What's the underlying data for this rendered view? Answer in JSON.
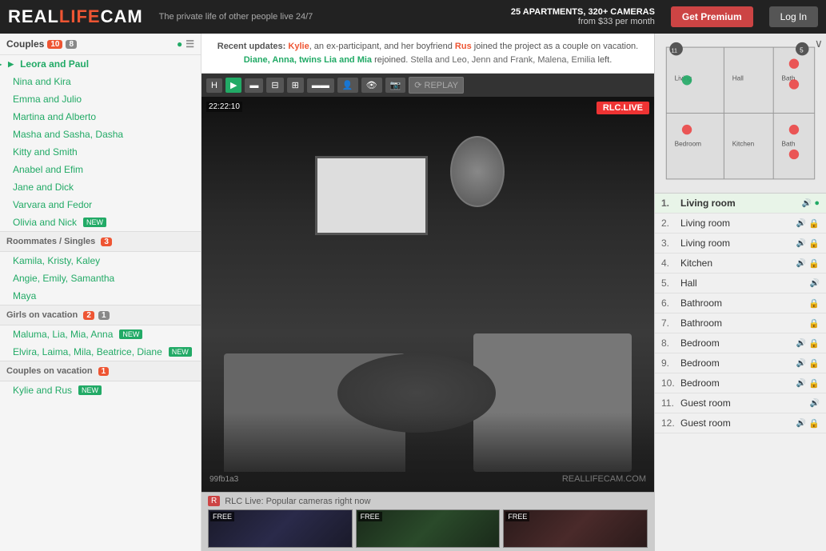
{
  "header": {
    "logo_real": "REAL",
    "logo_life": "LIFE",
    "logo_cam": "CAM",
    "tagline": "The private life of other people live 24/7",
    "stats_line1": "25 APARTMENTS, 320+ CAMERAS",
    "stats_line2": "from $33 per month",
    "btn_premium": "Get Premium",
    "btn_login": "Log In"
  },
  "news": {
    "text": "Recent updates: Kylie, an ex-participant, and her boyfriend Rus joined the project as a couple on vacation. Diane, Anna, twins Lia and Mia rejoined. Stella and Leo, Jenn and Frank, Malena, Emilia left.",
    "highlighted_names": [
      "Kylie",
      "Rus",
      "Diane, Anna, twins Lia and Mia",
      "Stella and Leo, Jenn and Frank, Malena, Emilia"
    ]
  },
  "sidebar": {
    "couples_label": "Couples",
    "couples_badge_green": "10",
    "couples_badge_gray": "8",
    "couples": [
      {
        "name": "Leora and Paul",
        "active": true
      },
      {
        "name": "Nina and Kira"
      },
      {
        "name": "Emma and Julio"
      },
      {
        "name": "Martina and Alberto"
      },
      {
        "name": "Masha and Sasha, Dasha"
      },
      {
        "name": "Kitty and Smith"
      },
      {
        "name": "Anabel and Efim"
      },
      {
        "name": "Jane and Dick"
      },
      {
        "name": "Varvara and Fedor"
      },
      {
        "name": "Olivia and Nick",
        "new": true
      }
    ],
    "roommates_label": "Roommates / Singles",
    "roommates_badge": "3",
    "roommates": [
      {
        "name": "Kamila, Kristy, Kaley"
      },
      {
        "name": "Angie, Emily, Samantha"
      },
      {
        "name": "Maya"
      }
    ],
    "girls_label": "Girls on vacation",
    "girls_badge_green": "2",
    "girls_badge_gray": "1",
    "girls": [
      {
        "name": "Maluma, Lia, Mia, Anna",
        "new": true
      },
      {
        "name": "Elvira, Laima, Mila, Beatrice, Diane",
        "new": true
      }
    ],
    "couples_vacation_label": "Couples on vacation",
    "couples_vacation_badge": "1",
    "couples_vacation": [
      {
        "name": "Kylie and Rus",
        "new": true
      }
    ]
  },
  "camera": {
    "timestamp": "22:22:10",
    "live_text": "RLC.LIVE",
    "watermark": "REALLIFECAM.COM",
    "cam_id": "99fb1a3"
  },
  "rooms": [
    {
      "num": "1.",
      "name": "Living room",
      "active": true,
      "sound": true,
      "green": true
    },
    {
      "num": "2.",
      "name": "Living room",
      "sound": true,
      "lock": true
    },
    {
      "num": "3.",
      "name": "Living room",
      "sound": true,
      "lock": true
    },
    {
      "num": "4.",
      "name": "Kitchen",
      "sound": true,
      "lock": true
    },
    {
      "num": "5.",
      "name": "Hall",
      "sound": true
    },
    {
      "num": "6.",
      "name": "Bathroom",
      "lock": true
    },
    {
      "num": "7.",
      "name": "Bathroom",
      "lock": true
    },
    {
      "num": "8.",
      "name": "Bedroom",
      "sound": true,
      "lock": true
    },
    {
      "num": "9.",
      "name": "Bedroom",
      "sound": true,
      "lock": true
    },
    {
      "num": "10.",
      "name": "Bedroom",
      "sound": true,
      "lock": true
    },
    {
      "num": "11.",
      "name": "Guest room",
      "sound": true
    },
    {
      "num": "12.",
      "name": "Guest room",
      "sound": true,
      "lock": true
    }
  ],
  "bottom": {
    "popular_label": "RLC Live: Popular cameras right now",
    "thumbs": [
      {
        "label": "FREE"
      },
      {
        "label": "FREE"
      },
      {
        "label": "FREE"
      }
    ]
  }
}
